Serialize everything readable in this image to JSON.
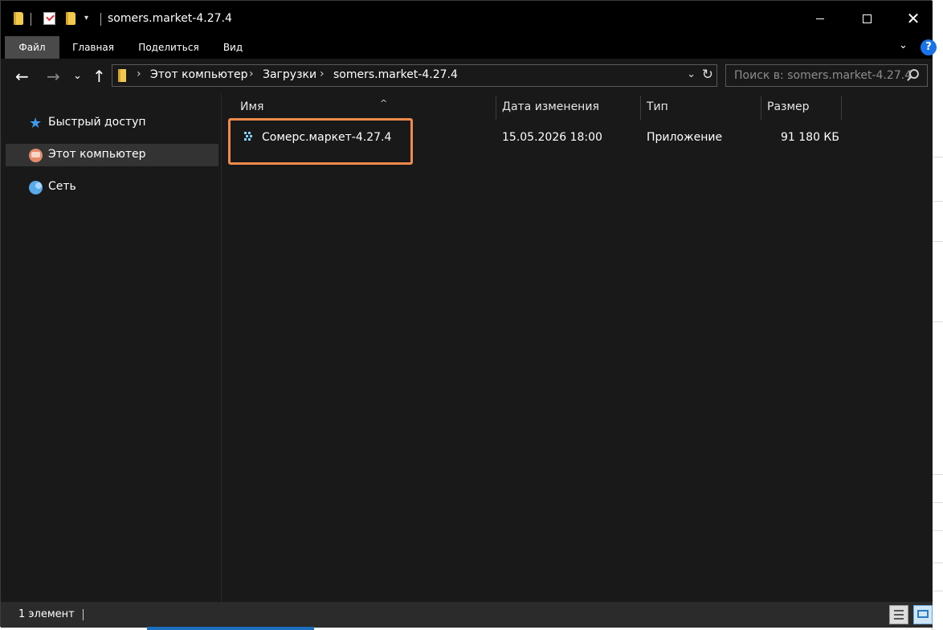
{
  "window": {
    "title": "somers.market-4.27.4"
  },
  "ribbon": {
    "tabs": [
      {
        "label": "Файл",
        "active": true
      },
      {
        "label": "Главная",
        "active": false
      },
      {
        "label": "Поделиться",
        "active": false
      },
      {
        "label": "Вид",
        "active": false
      }
    ],
    "help_label": "?"
  },
  "address_bar": {
    "crumbs": [
      "Этот компьютер",
      "Загрузки",
      "somers.market-4.27.4"
    ]
  },
  "search": {
    "placeholder": "Поиск в: somers.market-4.27.4"
  },
  "nav_pane": {
    "items": [
      {
        "label": "Быстрый доступ",
        "icon": "quick-access-star-icon"
      },
      {
        "label": "Этот компьютер",
        "icon": "this-pc-icon",
        "selected": true
      },
      {
        "label": "Сеть",
        "icon": "network-icon"
      }
    ]
  },
  "file_list": {
    "columns": [
      "Имя",
      "Дата изменения",
      "Тип",
      "Размер"
    ],
    "rows": [
      {
        "name": "Сомерс.маркет-4.27.4",
        "modified": "15.05.2026 18:00",
        "type": "Приложение",
        "size": "91 180 КБ"
      }
    ],
    "highlight_color": "#f08a4b"
  },
  "status_bar": {
    "item_count": "1 элемент"
  },
  "colors": {
    "window_bg": "#191919",
    "titlebar_bg": "#000000",
    "accent": "#1a73e8"
  }
}
